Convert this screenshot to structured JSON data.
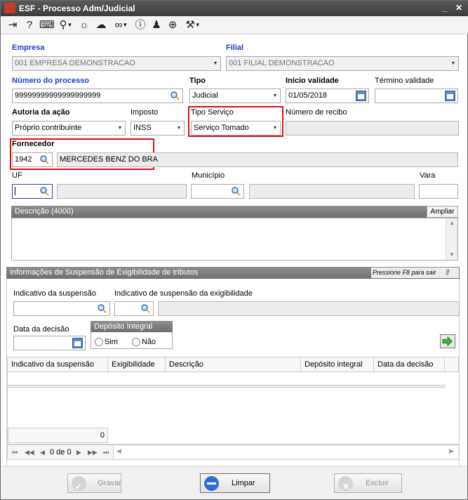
{
  "window": {
    "title": "ESF - Processo Adm/Judicial"
  },
  "toolbar": {
    "icons": [
      "exit-icon",
      "help-icon",
      "keyboard-icon",
      "search-icon",
      "lightbulb-icon",
      "cloud-icon",
      "link-icon",
      "info-icon",
      "user-icon",
      "document-add-icon",
      "tools-icon"
    ]
  },
  "form": {
    "empresa_label": "Empresa",
    "empresa_value": "001 EMPRESA DEMONSTRACAO",
    "filial_label": "Filial",
    "filial_value": "001 FILIAL DEMONSTRACAO",
    "numero_label": "Número do processo",
    "numero_value": "99999999999999999999",
    "tipo_label": "Tipo",
    "tipo_value": "Judicial",
    "inicio_label": "Início validade",
    "inicio_value": "01/05/2018",
    "termino_label": "Término validade",
    "termino_value": "",
    "autoria_label": "Autoria da ação",
    "autoria_value": "Próprio contribuinte",
    "imposto_label": "Imposto",
    "imposto_value": "INSS",
    "tiposervico_label": "Tipo Serviço",
    "tiposervico_value": "Serviço Tomado",
    "recibo_label": "Número de recibo",
    "recibo_value": "",
    "fornecedor_label": "Fornecedor",
    "fornecedor_code": "1942",
    "fornecedor_name": "MERCEDES BENZ DO BRA",
    "uf_label": "UF",
    "municipio_label": "Município",
    "vara_label": "Vara",
    "descricao_label": "Descrição (4000)",
    "ampliar_label": "Ampliar"
  },
  "suspensao": {
    "header": "Informações de Suspensão de Exigibilidade de tributos",
    "hint": "Pressione F8 para sair",
    "indicativo_label": "Indicativo da suspensão",
    "indicativo_exig_label": "Indicativo de suspensão da exigibilidade",
    "data_label": "Data da decisão",
    "deposito_label": "Depósito Integral",
    "sim_label": "Sim",
    "nao_label": "Não"
  },
  "grid": {
    "columns": [
      "Indicativo da suspensão",
      "Exigibilidade",
      "Descrição",
      "Depósito integral",
      "Data da decisão"
    ],
    "total": "0",
    "pager": "0 de 0"
  },
  "buttons": {
    "gravar": "Gravar",
    "limpar": "Limpar",
    "excluir": "Excluir"
  },
  "colors": {
    "required_label": "#1a3fc8",
    "highlight_box": "#e01010",
    "panel_header": "#7f7f7f"
  }
}
